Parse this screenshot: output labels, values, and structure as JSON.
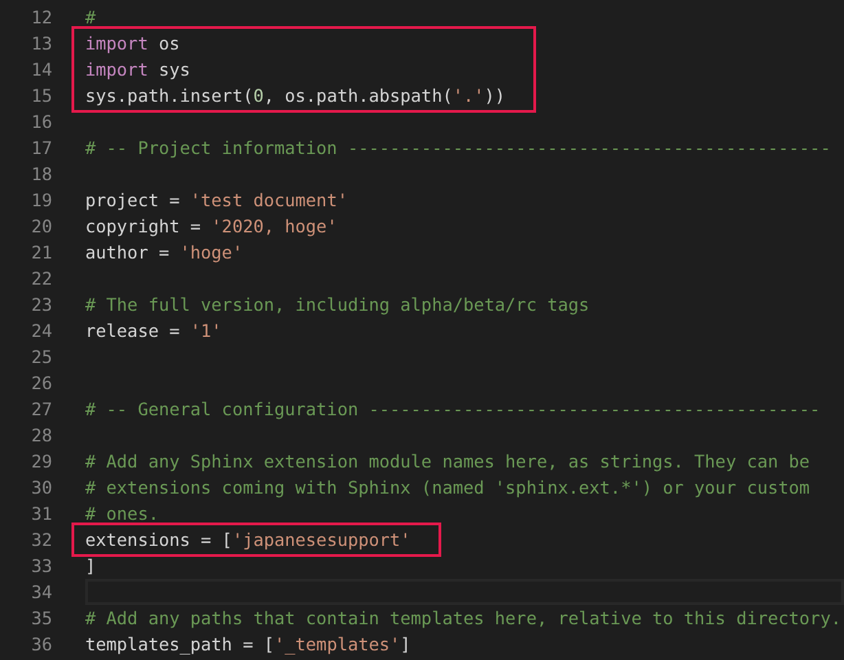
{
  "editor": {
    "lines": [
      {
        "number": "12",
        "tokens": [
          {
            "text": "#",
            "kind": "comment"
          }
        ]
      },
      {
        "number": "13",
        "boxed": true,
        "tokens": [
          {
            "text": "import",
            "kind": "keyword"
          },
          {
            "text": " os",
            "kind": "plain"
          }
        ]
      },
      {
        "number": "14",
        "boxed": true,
        "tokens": [
          {
            "text": "import",
            "kind": "keyword"
          },
          {
            "text": " sys",
            "kind": "plain"
          }
        ]
      },
      {
        "number": "15",
        "boxed": true,
        "tokens": [
          {
            "text": "sys.path.insert(",
            "kind": "plain"
          },
          {
            "text": "0",
            "kind": "number"
          },
          {
            "text": ", os.path.abspath(",
            "kind": "plain"
          },
          {
            "text": "'.'",
            "kind": "string"
          },
          {
            "text": "))",
            "kind": "plain"
          }
        ]
      },
      {
        "number": "16"
      },
      {
        "number": "17",
        "tokens": [
          {
            "text": "# -- Project information ----------------------------------------------",
            "kind": "comment"
          }
        ]
      },
      {
        "number": "18"
      },
      {
        "number": "19",
        "tokens": [
          {
            "text": "project = ",
            "kind": "plain"
          },
          {
            "text": "'test document'",
            "kind": "string"
          }
        ]
      },
      {
        "number": "20",
        "tokens": [
          {
            "text": "copyright = ",
            "kind": "plain"
          },
          {
            "text": "'2020, hoge'",
            "kind": "string"
          }
        ]
      },
      {
        "number": "21",
        "tokens": [
          {
            "text": "author = ",
            "kind": "plain"
          },
          {
            "text": "'hoge'",
            "kind": "string"
          }
        ]
      },
      {
        "number": "22"
      },
      {
        "number": "23",
        "tokens": [
          {
            "text": "# The full version, including alpha/beta/rc tags",
            "kind": "comment"
          }
        ]
      },
      {
        "number": "24",
        "tokens": [
          {
            "text": "release = ",
            "kind": "plain"
          },
          {
            "text": "'1'",
            "kind": "string"
          }
        ]
      },
      {
        "number": "25"
      },
      {
        "number": "26"
      },
      {
        "number": "27",
        "tokens": [
          {
            "text": "# -- General configuration -------------------------------------------",
            "kind": "comment"
          }
        ]
      },
      {
        "number": "28"
      },
      {
        "number": "29",
        "tokens": [
          {
            "text": "# Add any Sphinx extension module names here, as strings. They can be",
            "kind": "comment"
          }
        ]
      },
      {
        "number": "30",
        "tokens": [
          {
            "text": "# extensions coming with Sphinx (named 'sphinx.ext.*') or your custom",
            "kind": "comment"
          }
        ]
      },
      {
        "number": "31",
        "tokens": [
          {
            "text": "# ones.",
            "kind": "comment"
          }
        ]
      },
      {
        "number": "32",
        "boxed": true,
        "tokens": [
          {
            "text": "extensions = [",
            "kind": "plain"
          },
          {
            "text": "'japanesesupport'",
            "kind": "string"
          }
        ]
      },
      {
        "number": "33",
        "tokens": [
          {
            "text": "]",
            "kind": "plain"
          }
        ]
      },
      {
        "number": "34",
        "current": true
      },
      {
        "number": "35",
        "tokens": [
          {
            "text": "# Add any paths that contain templates here, relative to this directory.",
            "kind": "comment"
          }
        ]
      },
      {
        "number": "36",
        "tokens": [
          {
            "text": "templates_path = [",
            "kind": "plain"
          },
          {
            "text": "'_templates'",
            "kind": "string"
          },
          {
            "text": "]",
            "kind": "plain"
          }
        ]
      }
    ]
  }
}
